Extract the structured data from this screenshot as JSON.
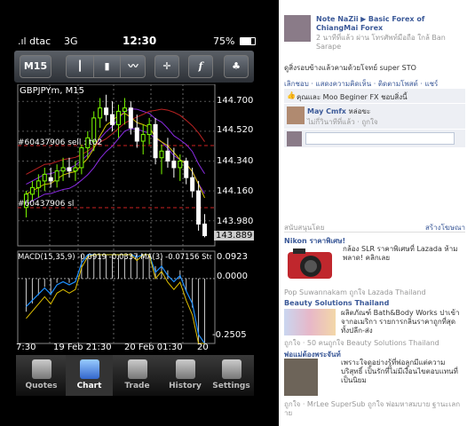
{
  "status": {
    "carrier": ".ıl dtac",
    "network": "3G",
    "time": "12:30",
    "battery": "75%"
  },
  "toolbar": {
    "timeframe": "M15"
  },
  "chart": {
    "symbol": "GBPJPYm, M15",
    "price_ticks": [
      "144.700",
      "144.520",
      "144.340",
      "144.160",
      "143.980"
    ],
    "current_price": "143.889",
    "order_label_1": "#60437906 sell : t02",
    "order_label_2": "#60437906 sl",
    "indicator_label": "MACD(15,35,9) -0.0919 -0.0337 MA(3) -0.07156 Stoch(",
    "indicator_ticks": [
      "0.0923",
      "0.0000",
      "-0.2505"
    ],
    "time_ticks": [
      "7:30",
      "19 Feb 21:30",
      "20 Feb 01:30",
      "20"
    ],
    "up_color": "#7cfc00",
    "down_color": "#ffffff"
  },
  "chart_data": {
    "type": "candlestick",
    "title": "GBPJPYm, M15",
    "ylim": [
      143.85,
      144.76
    ],
    "x": [
      "19 Feb 21:30",
      "20 Feb 01:30"
    ],
    "candles": [
      [
        144.06,
        144.16,
        144.0,
        144.14
      ],
      [
        144.14,
        144.22,
        144.1,
        144.18
      ],
      [
        144.18,
        144.26,
        144.12,
        144.22
      ],
      [
        144.22,
        144.3,
        144.16,
        144.26
      ],
      [
        144.24,
        144.3,
        144.18,
        144.22
      ],
      [
        144.22,
        144.32,
        144.18,
        144.28
      ],
      [
        144.28,
        144.36,
        144.22,
        144.3
      ],
      [
        144.3,
        144.36,
        144.24,
        144.28
      ],
      [
        144.28,
        144.34,
        144.22,
        144.3
      ],
      [
        144.3,
        144.44,
        144.26,
        144.42
      ],
      [
        144.42,
        144.52,
        144.36,
        144.48
      ],
      [
        144.46,
        144.64,
        144.4,
        144.6
      ],
      [
        144.6,
        144.72,
        144.54,
        144.66
      ],
      [
        144.66,
        144.74,
        144.58,
        144.62
      ],
      [
        144.62,
        144.7,
        144.52,
        144.56
      ],
      [
        144.56,
        144.68,
        144.48,
        144.64
      ],
      [
        144.64,
        144.72,
        144.56,
        144.66
      ],
      [
        144.66,
        144.7,
        144.5,
        144.54
      ],
      [
        144.54,
        144.62,
        144.42,
        144.46
      ],
      [
        144.46,
        144.56,
        144.38,
        144.5
      ],
      [
        144.5,
        144.6,
        144.44,
        144.56
      ],
      [
        144.56,
        144.6,
        144.32,
        144.36
      ],
      [
        144.36,
        144.44,
        144.26,
        144.4
      ],
      [
        144.4,
        144.48,
        144.3,
        144.34
      ],
      [
        144.34,
        144.42,
        144.24,
        144.3
      ],
      [
        144.3,
        144.38,
        144.22,
        144.34
      ],
      [
        144.34,
        144.36,
        144.2,
        144.24
      ],
      [
        144.24,
        144.3,
        144.12,
        144.16
      ],
      [
        144.16,
        144.22,
        143.92,
        143.96
      ],
      [
        143.96,
        144.02,
        143.88,
        143.89
      ]
    ],
    "macd_range": [
      -0.2505,
      0.0923
    ]
  },
  "tabs": [
    {
      "label": "Quotes",
      "icon": "quotes-icon"
    },
    {
      "label": "Chart",
      "icon": "chart-icon"
    },
    {
      "label": "Trade",
      "icon": "trade-icon"
    },
    {
      "label": "History",
      "icon": "history-icon"
    },
    {
      "label": "Settings",
      "icon": "settings-icon"
    }
  ],
  "fb": {
    "author": "Note NaZii",
    "arrow": "▶",
    "group": "Basic Forex of ChiangMai Forex",
    "meta": "2 นาทีที่แล้ว ผ่าน โทรศัพท์มือถือ ใกล้ Ban Sarape",
    "post_text": "ดูสิ่งรอบข้างแล้วคามด้วยโจทย์ super STO",
    "actions": "เลิกชอบ · แสดงความคิดเห็น · ติดตามโพสต์ · แชร์",
    "likes": "คุณและ Moo Beginer FX ชอบสิ่งนี้",
    "comment_author": "May Cmfx",
    "comment_text": "หล่อขะ",
    "comment_meta": "ไม่กี่วินาทีที่แล้ว · ถูกใจ",
    "sponsored": "สนับสนุนโดย",
    "create_ad": "สร้างโฆษณา",
    "ad1_title": "Nikon ราคาพิเศษ!",
    "ad1_text": "กล้อง SLR ราคาพิเศษที่ Lazada ห้ามพลาด! คลิกเลย",
    "ad1_social": "Pop Suwannakam ถูกใจ Lazada Thailand",
    "ad2_title": "Beauty Solutions Thailand",
    "ad2_text": "ผลิตภัณฑ์ Bath&Body Works ปาเข้าจากอเมริกา รายการกลิ่นราคาถูกที่สุด ทั้งปลีก-ส่ง",
    "ad2_social": "ถูกใจ · 50 คนถูกใจ Beauty Solutions Thailand",
    "ad3_title": "พ่อแม่ต้องพระจันท์",
    "ad3_text": "เพราะใจดูอย่างรู้ที่พ่อลูกมีแต่ความบริสุทธิ์ เป็นรักที่ไม่มีเงื่อนไขตอบแทนที่เป็นนิยม",
    "ad3_social": "ถูกใจ · MrLee SuperSub ถูกใจ พ่อมหาสมบาย ฐานะเลกาย"
  }
}
